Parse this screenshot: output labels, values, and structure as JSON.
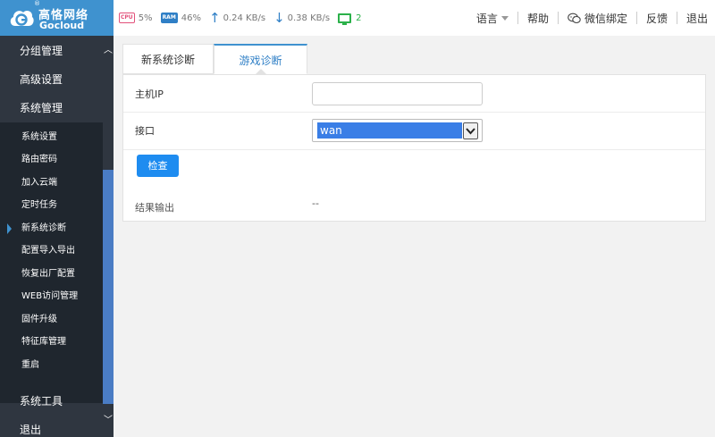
{
  "header": {
    "logo": {
      "cn": "高恪网络",
      "en": "Gocloud",
      "reg": "®"
    },
    "stats": {
      "cpu_chip": "CPU",
      "cpu": "5%",
      "ram_chip": "RAM",
      "ram": "46%",
      "upload": "0.24 KB/s",
      "download": "0.38 KB/s",
      "terminals": "2"
    },
    "nav": {
      "language": "语言",
      "help": "帮助",
      "wechat": "微信绑定",
      "feedback": "反馈",
      "logout": "退出"
    }
  },
  "sidebar": {
    "main": [
      "分组管理",
      "高级设置",
      "系统管理",
      "系统工具",
      "退出"
    ],
    "sub": [
      "系统设置",
      "路由密码",
      "加入云端",
      "定时任务",
      "新系统诊断",
      "配置导入导出",
      "恢复出厂配置",
      "WEB访问管理",
      "固件升级",
      "特征库管理",
      "重启"
    ],
    "active_sub": "新系统诊断"
  },
  "tabs": [
    "新系统诊断",
    "游戏诊断"
  ],
  "active_tab": "游戏诊断",
  "form": {
    "host_ip_label": "主机IP",
    "host_ip_value": "",
    "interface_label": "接口",
    "interface_value": "wan",
    "check_button": "检查",
    "result_label": "结果输出",
    "result_value": "--"
  },
  "colors": {
    "brand": "#3f92cf",
    "primary_button": "#1e8cf0",
    "sidebar_bg": "#2f3640",
    "submenu_bg": "#1f262e",
    "selection": "#3a7ee6"
  }
}
